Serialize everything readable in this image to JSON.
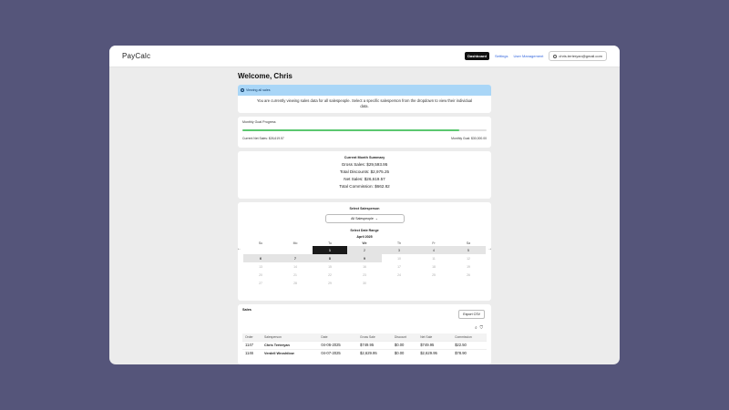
{
  "app": {
    "brand": "PayCalc"
  },
  "nav": {
    "dashboard": "Dashboard",
    "settings": "Settings",
    "user_mgmt": "User Management",
    "email": "chris.terteryan@gmail.com"
  },
  "welcome": "Welcome, Chris",
  "alert": {
    "title": "Viewing all sales",
    "body": "You are currently viewing sales data for all salespeople. Select a specific salesperson from the dropdown to view their individual data."
  },
  "goal": {
    "title": "Monthly Goal Progress",
    "current": "Current Net Sales: $26,619.57",
    "goal": "Monthly Goal: $30,000.00",
    "progress": 0.887
  },
  "summary": {
    "title": "Current Month Summary",
    "gross": "Gross Sales: $29,593.95",
    "discounts": "Total Discounts: $2,975.25",
    "net": "Net Sales: $26,619.57",
    "commission": "Total Commission: $662.82"
  },
  "salesperson": {
    "title": "Select Salesperson",
    "selected": "All Salespeople"
  },
  "calendar": {
    "title": "Select Date Range",
    "month": "April 2025",
    "prev": "←",
    "next": "→",
    "weekdays": [
      "Su",
      "Mo",
      "Tu",
      "We",
      "Th",
      "Fr",
      "Sa"
    ],
    "weeks": [
      [
        "",
        "",
        "1",
        "2",
        "3",
        "4",
        "5"
      ],
      [
        "6",
        "7",
        "8",
        "9",
        "10",
        "11",
        "12"
      ],
      [
        "13",
        "14",
        "15",
        "16",
        "17",
        "18",
        "19"
      ],
      [
        "20",
        "21",
        "22",
        "23",
        "24",
        "25",
        "26"
      ],
      [
        "27",
        "28",
        "29",
        "30",
        "",
        "",
        ""
      ]
    ]
  },
  "sales": {
    "title": "Sales",
    "export": "Export CSV",
    "columns": [
      "Order",
      "Salesperson",
      "Date",
      "Gross Sale",
      "Discount",
      "Net Sale",
      "Commission"
    ],
    "rows": [
      [
        "1147",
        "Chris Terteryan",
        "04-06-2025",
        "$749.95",
        "$0.00",
        "$749.95",
        "$22.50"
      ],
      [
        "1146",
        "Verdell Wroshilow",
        "04-07-2025",
        "$2,629.95",
        "$0.00",
        "$2,629.95",
        "$78.90"
      ]
    ]
  }
}
